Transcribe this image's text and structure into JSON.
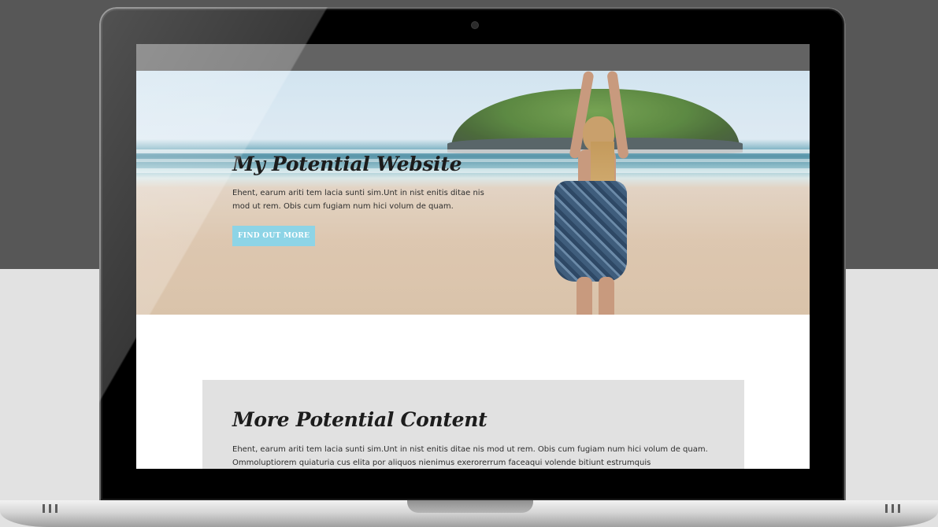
{
  "hero": {
    "title": "My Potential Website",
    "body": "Ehent, earum ariti tem lacia sunti sim.Unt in nist enitis ditae nis mod ut rem. Obis cum fugiam num hici volum de quam.",
    "cta_label": "FIND OUT MORE"
  },
  "content": {
    "title": "More Potential Content",
    "body": "Ehent, earum ariti tem lacia sunti sim.Unt in nist enitis ditae nis mod ut rem. Obis cum fugiam num hici volum de quam. Ommoluptiorem quiaturia cus elita por aliquos nienimus exerorerrum faceaqui volende bitiunt estrumquis"
  },
  "colors": {
    "page_top": "#575757",
    "page_bottom": "#e2e2e2",
    "cta": "#8dd4e6",
    "content_box": "#e1e1e1"
  },
  "icons": [
    "camera-icon",
    "vent-icon"
  ]
}
